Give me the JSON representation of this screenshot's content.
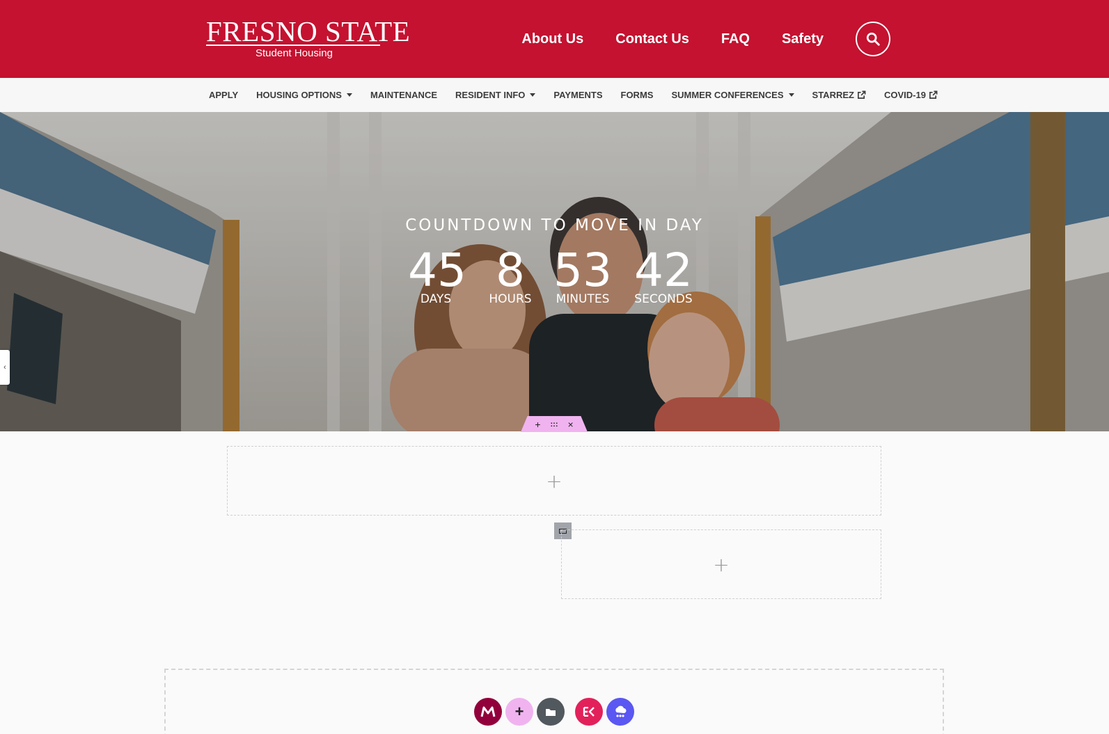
{
  "header": {
    "logo_word": "FRESNO STATE",
    "logo_sub": "Student Housing",
    "nav": [
      "About Us",
      "Contact Us",
      "FAQ",
      "Safety"
    ],
    "search_icon": "search-icon",
    "brand_color": "#c41230"
  },
  "subnav": {
    "items": [
      {
        "label": "APPLY",
        "dropdown": false,
        "external": false
      },
      {
        "label": "HOUSING OPTIONS",
        "dropdown": true,
        "external": false
      },
      {
        "label": "MAINTENANCE",
        "dropdown": false,
        "external": false
      },
      {
        "label": "RESIDENT INFO",
        "dropdown": true,
        "external": false
      },
      {
        "label": "PAYMENTS",
        "dropdown": false,
        "external": false
      },
      {
        "label": "FORMS",
        "dropdown": false,
        "external": false
      },
      {
        "label": "SUMMER CONFERENCES",
        "dropdown": true,
        "external": false
      },
      {
        "label": "STARREZ",
        "dropdown": false,
        "external": true
      },
      {
        "label": "COVID-19",
        "dropdown": false,
        "external": true
      }
    ]
  },
  "hero": {
    "title": "COUNTDOWN TO MOVE IN DAY",
    "countdown": [
      {
        "value": "45",
        "label": "DAYS"
      },
      {
        "value": "8",
        "label": "HOURS"
      },
      {
        "value": "53",
        "label": "MINUTES"
      },
      {
        "value": "42",
        "label": "SECONDS"
      }
    ],
    "toolbar": {
      "add": "+",
      "move": ":::",
      "close": "×"
    }
  },
  "editor": {
    "plus": "+",
    "toolbar_colors": [
      "#92003b",
      "#f0b3f0",
      "#51585e",
      "#e2215a",
      "#5b57f2"
    ],
    "tool_icons": [
      "m-logo-icon",
      "add-icon",
      "folder-icon",
      "elementskit-icon",
      "cloud-icon"
    ]
  }
}
